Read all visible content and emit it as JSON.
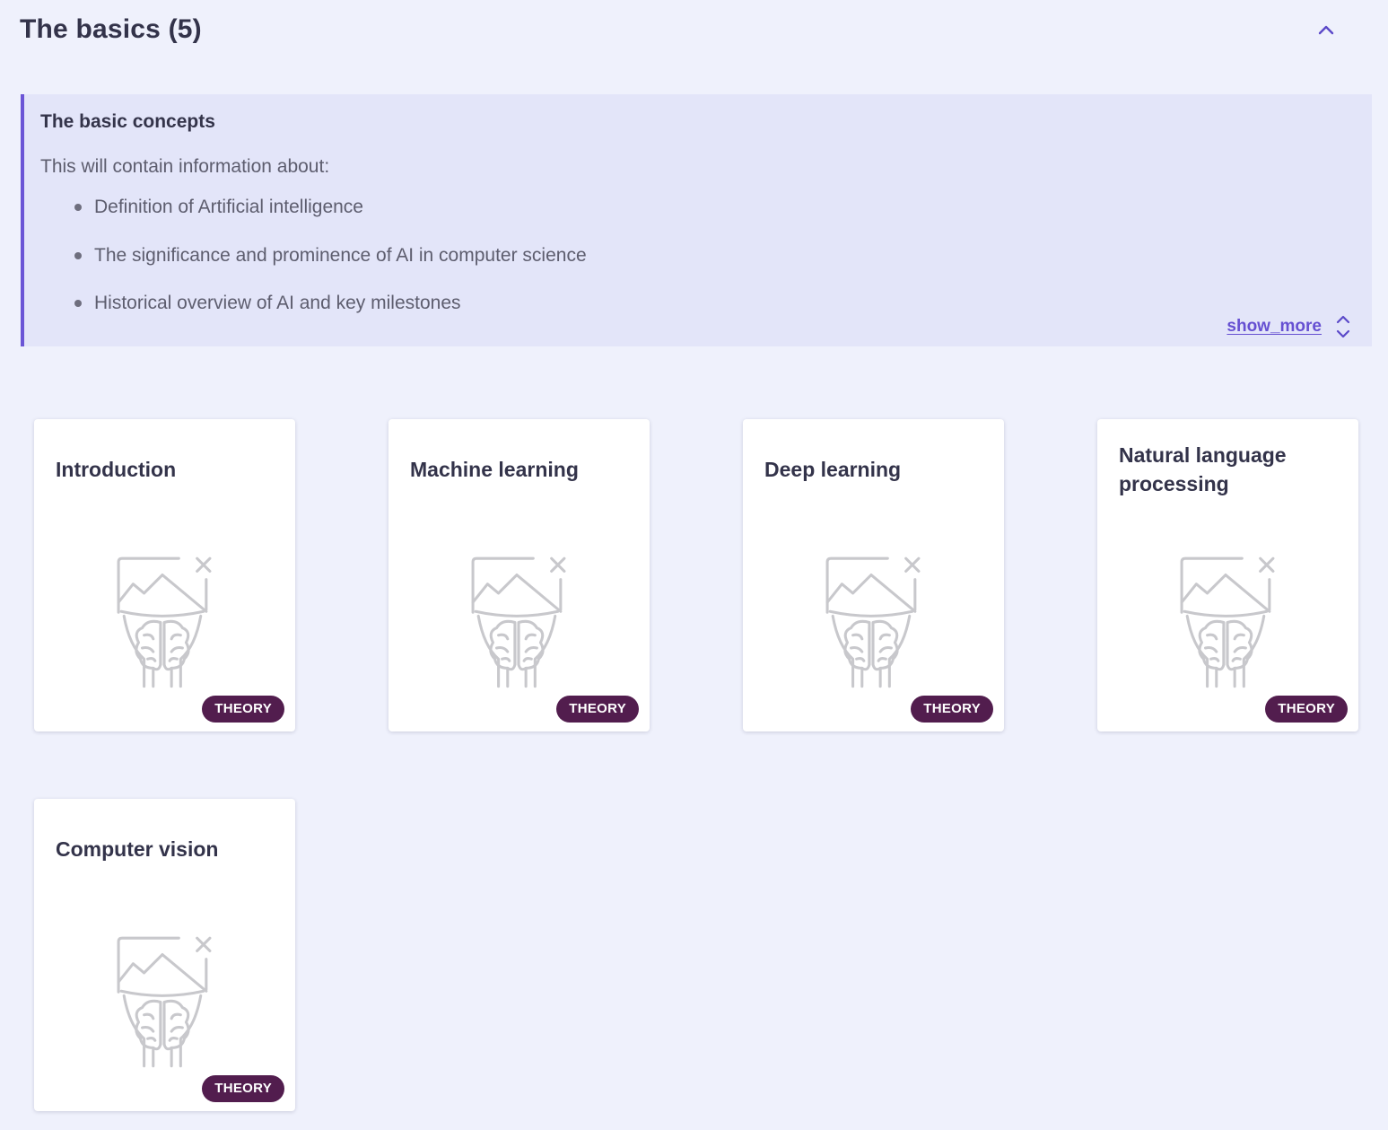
{
  "section": {
    "title": "The basics (5)",
    "collapse_icon": "chevron-up-icon",
    "accent_color": "#6b55d6"
  },
  "description": {
    "heading": "The basic concepts",
    "intro": "This will contain information about:",
    "items": [
      "Definition of Artificial intelligence",
      "The significance and prominence of AI in computer science",
      "Historical overview of AI and key milestones"
    ],
    "show_more_label": "show_more",
    "show_more_icon": "chevron-up-down-icon"
  },
  "cards": [
    {
      "title": "Introduction",
      "badge": "THEORY",
      "image": "broken-image-brain-icon"
    },
    {
      "title": "Machine learning",
      "badge": "THEORY",
      "image": "broken-image-brain-icon"
    },
    {
      "title": "Deep learning",
      "badge": "THEORY",
      "image": "broken-image-brain-icon"
    },
    {
      "title": "Natural language processing",
      "badge": "THEORY",
      "image": "broken-image-brain-icon"
    },
    {
      "title": "Computer vision",
      "badge": "THEORY",
      "image": "broken-image-brain-icon"
    }
  ],
  "colors": {
    "page_background": "#eff1fc",
    "description_background": "#e3e5f9",
    "badge_background": "#521d4e",
    "link": "#6650d2"
  }
}
